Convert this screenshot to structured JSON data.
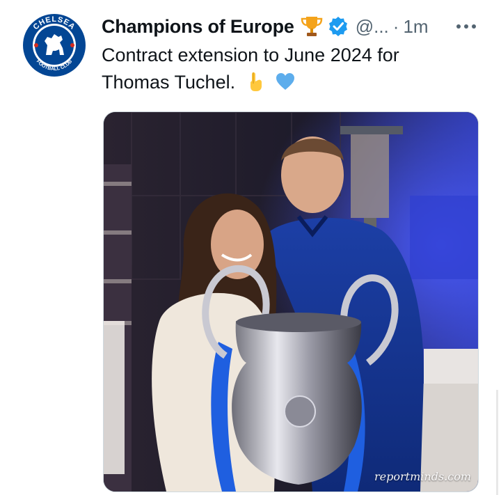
{
  "tweet": {
    "display_name": "Champions of Europe",
    "handle": "@...",
    "separator": "·",
    "time": "1m",
    "text_line1": "Contract extension to June 2024 for",
    "text_line2": "Thomas Tuchel.",
    "verified": true
  },
  "avatar": {
    "badge_top": "CHELSEA",
    "badge_bottom": "FOOTBALL CLUB",
    "colors": {
      "blue": "#034694",
      "red": "#d52b1e",
      "white": "#ffffff"
    }
  },
  "icons": {
    "trophy": "trophy-emoji",
    "verified": "verified-badge-icon",
    "more": "more-options-icon",
    "point_down": "backhand-index-pointing-down-emoji",
    "heart": "blue-heart-emoji"
  },
  "media": {
    "watermark": "reportminds.com"
  },
  "colors": {
    "text": "#0f1419",
    "secondary": "#536471",
    "verified": "#1d9bf0",
    "border": "#cfd9de"
  }
}
